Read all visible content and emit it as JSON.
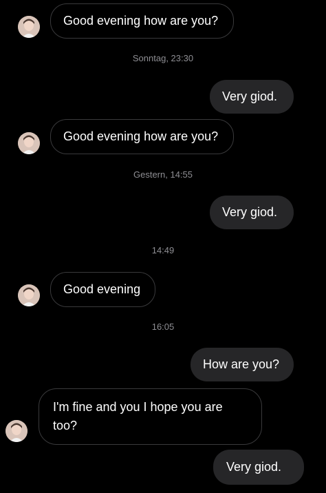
{
  "conversation": {
    "messages": [
      {
        "id": "m1",
        "direction": "incoming",
        "text": "Good evening how are you?"
      },
      {
        "id": "t1",
        "type": "timestamp",
        "text": "Sonntag, 23:30"
      },
      {
        "id": "m2",
        "direction": "outgoing",
        "text": "Very giod."
      },
      {
        "id": "m3",
        "direction": "incoming",
        "text": "Good evening how are you?"
      },
      {
        "id": "t2",
        "type": "timestamp",
        "text": "Gestern, 14:55"
      },
      {
        "id": "m4",
        "direction": "outgoing",
        "text": "Very giod."
      },
      {
        "id": "t3",
        "type": "timestamp",
        "text": "14:49"
      },
      {
        "id": "m5",
        "direction": "incoming",
        "text": "Good evening"
      },
      {
        "id": "t4",
        "type": "timestamp",
        "text": "16:05"
      },
      {
        "id": "m6",
        "direction": "outgoing",
        "text": "How are you?"
      },
      {
        "id": "m7",
        "direction": "incoming",
        "text": "I'm fine and you I hope you are too?"
      },
      {
        "id": "m8",
        "direction": "outgoing",
        "text": "Very giod."
      }
    ]
  },
  "colors": {
    "background": "#000000",
    "outgoing_bubble": "#262628",
    "incoming_bubble_border": "#3a3a3c",
    "timestamp_text": "#8e8e93"
  },
  "icons": {
    "avatar": "contact-avatar-photo"
  }
}
